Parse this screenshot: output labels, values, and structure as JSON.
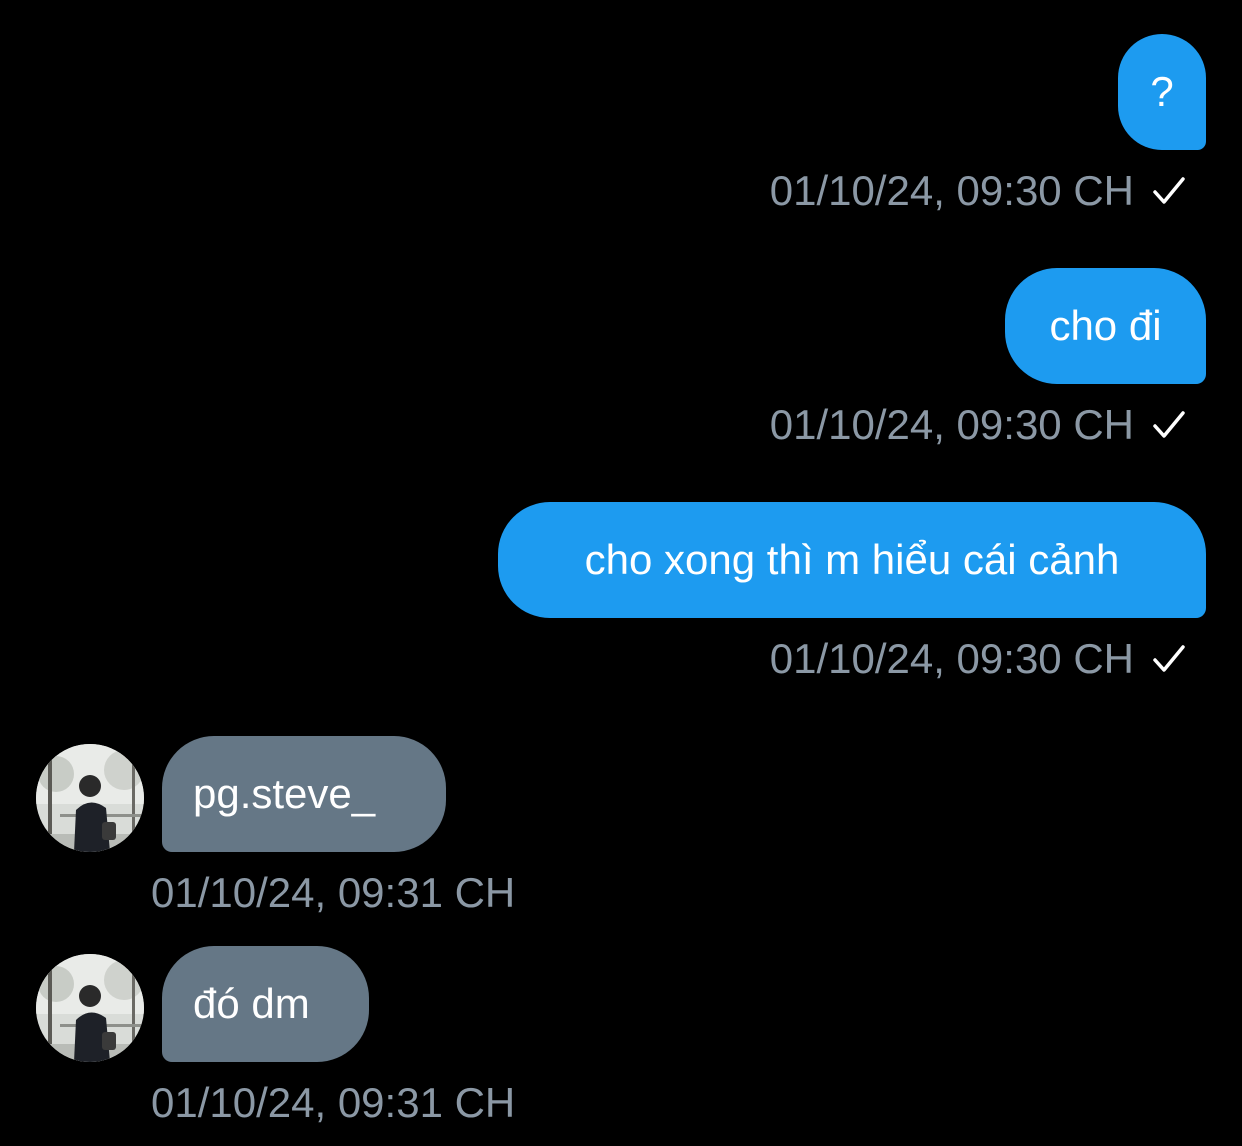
{
  "messages": [
    {
      "direction": "outgoing",
      "text": "?",
      "timestamp": "01/10/24, 09:30 CH",
      "status": "check-icon"
    },
    {
      "direction": "outgoing",
      "text": "cho đi",
      "timestamp": "01/10/24, 09:30 CH",
      "status": "check-icon"
    },
    {
      "direction": "outgoing",
      "text": "cho xong thì m hiểu cái cảnh",
      "timestamp": "01/10/24, 09:30 CH",
      "status": "check-icon"
    },
    {
      "direction": "incoming",
      "text": "pg.steve_",
      "timestamp": "01/10/24, 09:31 CH",
      "avatar": "user-avatar"
    },
    {
      "direction": "incoming",
      "text": "đó dm",
      "timestamp": "01/10/24, 09:31 CH",
      "avatar": "user-avatar"
    }
  ],
  "colors": {
    "background": "#000000",
    "outgoing_bubble": "#1d9bf0",
    "incoming_bubble": "#657786",
    "timestamp": "#8b98a5",
    "text": "#ffffff"
  }
}
